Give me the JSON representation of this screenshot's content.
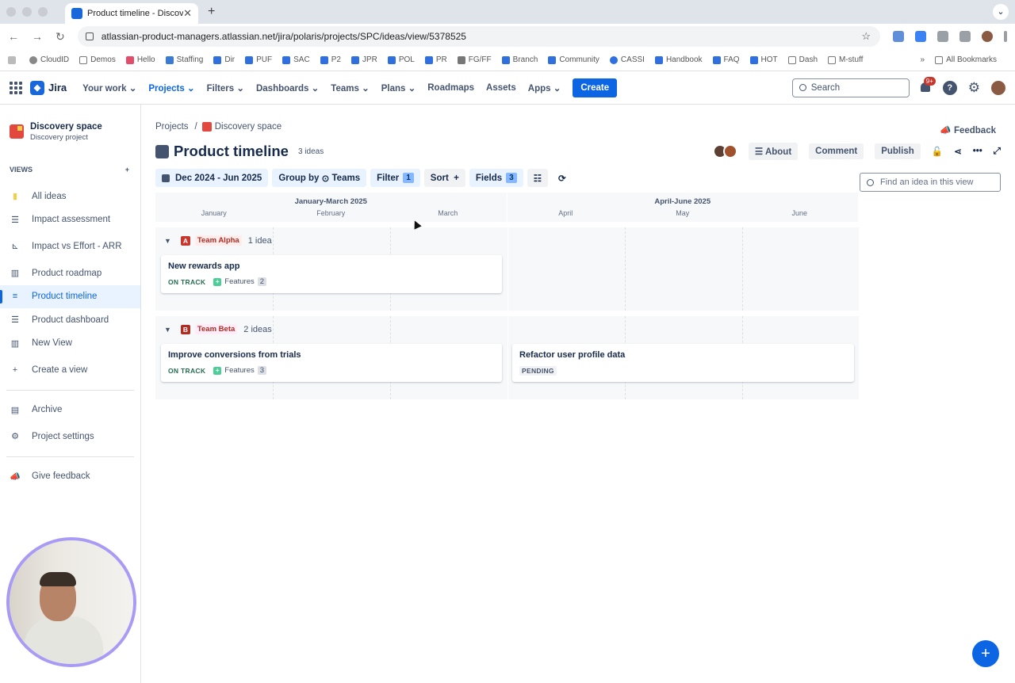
{
  "browser": {
    "tab_title": "Product timeline - Discovery",
    "url": "atlassian-product-managers.atlassian.net/jira/polaris/projects/SPC/ideas/view/5378525",
    "bookmarks": [
      "CloudID",
      "Demos",
      "Hello",
      "Staffing",
      "Dir",
      "PUF",
      "SAC",
      "P2",
      "JPR",
      "POL",
      "PR",
      "FG/FF",
      "Branch",
      "Community",
      "CASSI",
      "Handbook",
      "FAQ",
      "HOT",
      "Dash",
      "M-stuff"
    ],
    "all_bookmarks": "All Bookmarks"
  },
  "topnav": {
    "product": "Jira",
    "items": [
      "Your work",
      "Projects",
      "Filters",
      "Dashboards",
      "Teams",
      "Plans",
      "Roadmaps",
      "Assets",
      "Apps"
    ],
    "create": "Create",
    "search_placeholder": "Search",
    "notif_badge": "9+"
  },
  "sidebar": {
    "project_name": "Discovery space",
    "project_type": "Discovery project",
    "views_heading": "VIEWS",
    "views": [
      "All ideas",
      "Impact assessment",
      "Impact vs Effort - ARR",
      "Product roadmap",
      "Product timeline",
      "Product dashboard",
      "New View"
    ],
    "create_view": "Create a view",
    "archive": "Archive",
    "settings": "Project settings",
    "give_feedback": "Give feedback"
  },
  "page": {
    "breadcrumb_projects": "Projects",
    "breadcrumb_sep": "/",
    "breadcrumb_space": "Discovery space",
    "feedback": "Feedback",
    "title": "Product timeline",
    "idea_count": "3 ideas",
    "about": "About",
    "comment": "Comment",
    "publish": "Publish"
  },
  "toolbar": {
    "date_range": "Dec 2024 - Jun 2025",
    "group_by_label": "Group by",
    "group_by_value": "Teams",
    "filter": "Filter",
    "filter_count": "1",
    "sort": "Sort",
    "sort_plus": "+",
    "fields": "Fields",
    "fields_count": "3",
    "find_placeholder": "Find an idea in this view"
  },
  "timeline": {
    "quarters": [
      {
        "label": "January-March 2025",
        "months": [
          "January",
          "February",
          "March"
        ]
      },
      {
        "label": "April-June 2025",
        "months": [
          "April",
          "May",
          "June"
        ]
      }
    ],
    "groups": [
      {
        "letter": "A",
        "name": "Team Alpha",
        "count": "1 idea",
        "color": "#c9372c",
        "bg": "#ffeceb",
        "cards": [
          {
            "title": "New rewards app",
            "status": "ON TRACK",
            "status_color": "#216e4e",
            "features_label": "Features",
            "features_count": "2"
          }
        ]
      },
      {
        "letter": "B",
        "name": "Team Beta",
        "count": "2 ideas",
        "color": "#ae2e24",
        "bg": "#ffecf8",
        "cards": [
          {
            "title": "Improve conversions from trials",
            "status": "ON TRACK",
            "status_color": "#216e4e",
            "features_label": "Features",
            "features_count": "3"
          },
          {
            "title": "Refactor user profile data",
            "status": "PENDING"
          }
        ]
      }
    ]
  },
  "colors": {
    "accent": "#0c66e4",
    "sidebar_active_bg": "#e9f2ff"
  }
}
